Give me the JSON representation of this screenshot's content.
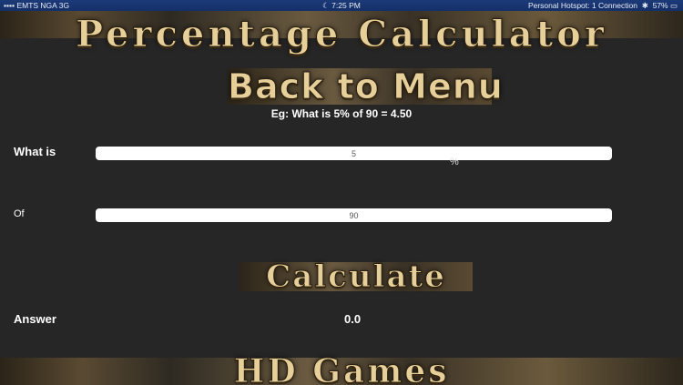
{
  "status_bar": {
    "carrier": "EMTS NGA",
    "network": "3G",
    "time": "7:25 PM",
    "hotspot": "Personal Hotspot: 1 Connection",
    "battery": "57%"
  },
  "app": {
    "title": "Percentage Calculator",
    "footer": "HD Games"
  },
  "menu": {
    "back_label": "Back to Menu"
  },
  "example": "Eg: What is 5% of 90 = 4.50",
  "form": {
    "what_is_label": "What is",
    "percent_value": "5",
    "percent_symbol": "%",
    "of_label": "Of",
    "of_value": "90",
    "calculate_label": "Calculate",
    "answer_label": "Answer",
    "answer_value": "0.0"
  },
  "colors": {
    "background": "#262626",
    "gold": "#e6cf98",
    "status_bar": "#1c3a78"
  }
}
